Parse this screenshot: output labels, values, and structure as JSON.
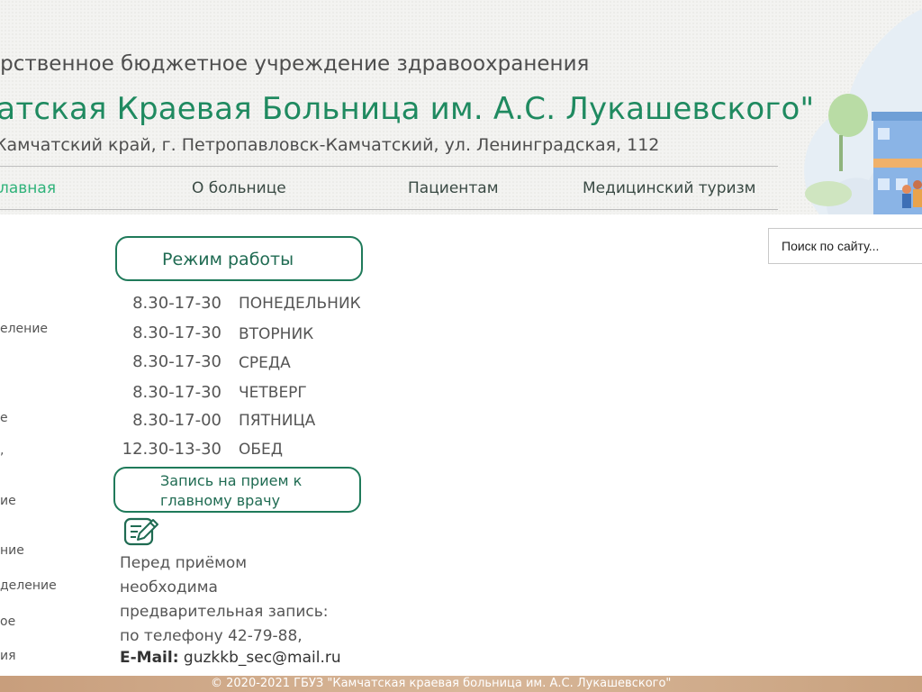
{
  "header": {
    "org_line": "арственное бюджетное учреждение здравоохранения",
    "org_name": "чатская Краевая Больница им. А.С. Лукашевского\"",
    "address": "Камчатский край, г. Петропавловск-Камчатский,  ул. Ленинградская, 112"
  },
  "nav": {
    "items": [
      {
        "label": "лавная",
        "active": true
      },
      {
        "label": "О больнице",
        "active": false
      },
      {
        "label": "Пациентам",
        "active": false
      },
      {
        "label": "Медицинский туризм",
        "active": false
      }
    ]
  },
  "sidebar": {
    "items": [
      {
        "label": "еление"
      },
      {
        "label": "е"
      },
      {
        "label": ","
      },
      {
        "label": "ие"
      },
      {
        "label": "ние"
      },
      {
        "label": "деление"
      },
      {
        "label": "ое"
      },
      {
        "label": "ия"
      }
    ]
  },
  "search": {
    "placeholder": "Поиск по сайту..."
  },
  "schedule": {
    "title": "Режим работы",
    "rows": [
      {
        "time": "8.30-17-30",
        "day": "ПОНЕДЕЛЬНИК"
      },
      {
        "time": "8.30-17-30",
        "day": "ВТОРНИК"
      },
      {
        "time": "8.30-17-30",
        "day": "СРЕДА"
      },
      {
        "time": "8.30-17-30",
        "day": "ЧЕТВЕРГ"
      },
      {
        "time": "8.30-17-00",
        "day": "ПЯТНИЦА"
      },
      {
        "time": "12.30-13-30",
        "day": "ОБЕД"
      }
    ]
  },
  "appointment": {
    "button_label": "Запись на прием к главному врачу",
    "icon": "edit-icon",
    "note_lines": [
      "Перед приёмом",
      "необходима",
      "предварительная запись:",
      "по телефону 42-79-88,"
    ],
    "email_label": "E-Mail:",
    "email_value": "guzkkb_sec@mail.ru"
  },
  "footer": {
    "copyright": "© 2020-2021  ГБУЗ \"Камчатская краевая больница им. А.С. Лукашевского\""
  },
  "colors": {
    "brand_green": "#1f8a60",
    "active_nav": "#2fb37a",
    "pill_border": "#1f7a5a",
    "footer_tan": "#d2ad8c"
  }
}
